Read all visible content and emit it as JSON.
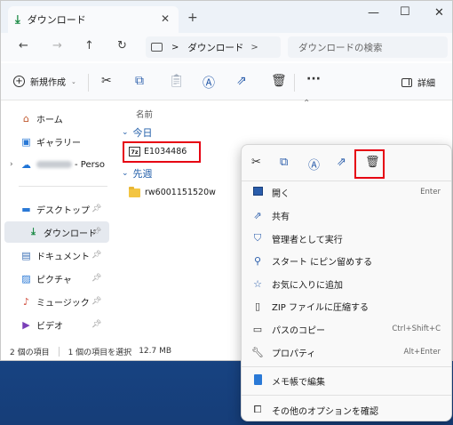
{
  "window": {
    "tab_title": "ダウンロード",
    "new_tab": "+",
    "minimize": "—",
    "maximize": "☐",
    "close": "✕"
  },
  "nav": {
    "back": "←",
    "forward": "→",
    "up": "↑",
    "refresh": "↻",
    "breadcrumb_sep": ">",
    "breadcrumb": "ダウンロード",
    "breadcrumb_trail_sep": ">",
    "search_placeholder": "ダウンロードの検索"
  },
  "toolbar": {
    "new_label": "新規作成",
    "details_label": "詳細",
    "more": "···"
  },
  "sidebar": {
    "home": "ホーム",
    "gallery": "ギャラリー",
    "onedrive_suffix": "- Perso",
    "desktop": "デスクトップ",
    "downloads": "ダウンロード",
    "documents": "ドキュメント",
    "pictures": "ピクチャ",
    "music": "ミュージック",
    "videos": "ビデオ"
  },
  "main": {
    "column_name": "名前",
    "group_today": "今日",
    "group_last_week": "先週",
    "files_today": [
      "E1034486"
    ],
    "files_last_week": [
      "rw6001151520w"
    ]
  },
  "status": {
    "item_count": "2 個の項目",
    "selected": "1 個の項目を選択",
    "size": "12.7 MB"
  },
  "context_menu": {
    "items": [
      {
        "label": "開く",
        "shortcut": "Enter",
        "icon": "open-icon"
      },
      {
        "label": "共有",
        "shortcut": "",
        "icon": "share-icon"
      },
      {
        "label": "管理者として実行",
        "shortcut": "",
        "icon": "shield-icon"
      },
      {
        "label": "スタート にピン留めする",
        "shortcut": "",
        "icon": "pin-icon"
      },
      {
        "label": "お気に入りに追加",
        "shortcut": "",
        "icon": "star-icon"
      },
      {
        "label": "ZIP ファイルに圧縮する",
        "shortcut": "",
        "icon": "zip-icon"
      },
      {
        "label": "パスのコピー",
        "shortcut": "Ctrl+Shift+C",
        "icon": "copy-path-icon"
      },
      {
        "label": "プロパティ",
        "shortcut": "Alt+Enter",
        "icon": "wrench-icon"
      },
      {
        "label": "メモ帳で編集",
        "shortcut": "",
        "icon": "notepad-icon"
      },
      {
        "label": "その他のオプションを確認",
        "shortcut": "",
        "icon": "more-options-icon"
      }
    ]
  },
  "colors": {
    "accent": "#2a5dab",
    "highlight": "#e60012",
    "folder": "#f3c542"
  }
}
